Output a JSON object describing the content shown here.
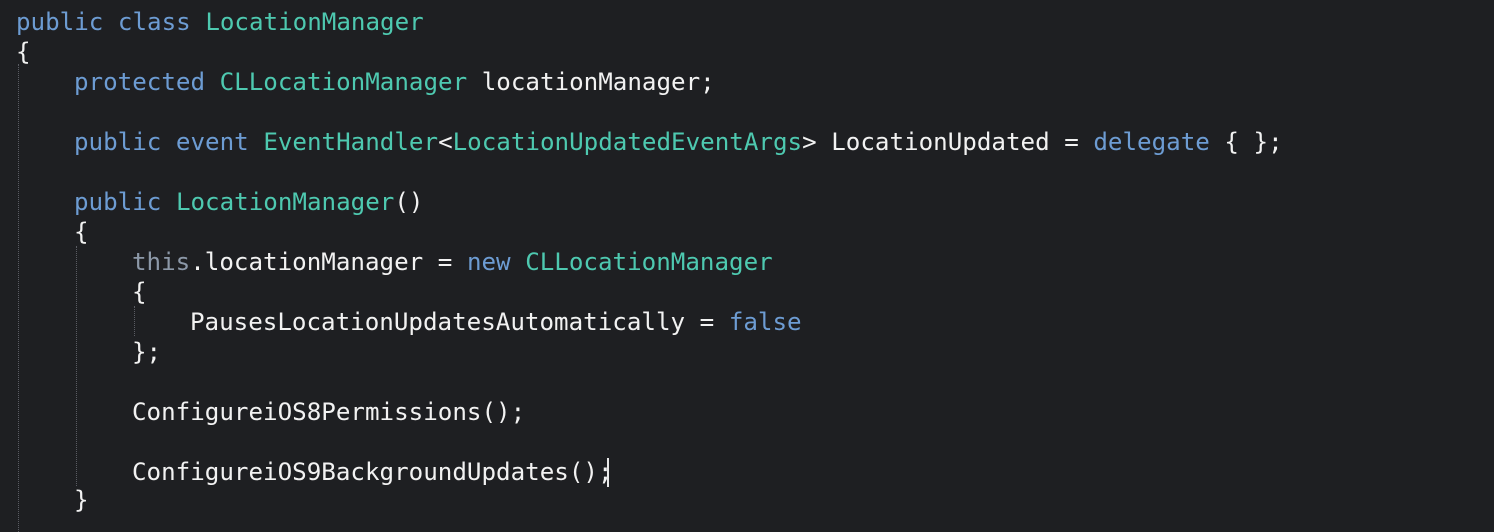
{
  "editor": {
    "colors": {
      "background": "#1e1f22",
      "keyword": "#6d9cd3",
      "type": "#4ec9b0",
      "this_keyword": "#8c98a8",
      "text": "#f2f2f2"
    },
    "lines": [
      {
        "indent": 0,
        "tokens": [
          {
            "t": "public class ",
            "c": "kw"
          },
          {
            "t": "LocationManager",
            "c": "ty"
          }
        ]
      },
      {
        "indent": 0,
        "tokens": [
          {
            "t": "{",
            "c": "tx"
          }
        ]
      },
      {
        "indent": 1,
        "tokens": [
          {
            "t": "protected ",
            "c": "kw"
          },
          {
            "t": "CLLocationManager",
            "c": "ty"
          },
          {
            "t": " locationManager;",
            "c": "tx"
          }
        ]
      },
      {
        "indent": 1,
        "tokens": [
          {
            "t": "public event ",
            "c": "kw"
          },
          {
            "t": "EventHandler",
            "c": "ty"
          },
          {
            "t": "<",
            "c": "tx"
          },
          {
            "t": "LocationUpdatedEventArgs",
            "c": "ty"
          },
          {
            "t": "> LocationUpdated = ",
            "c": "tx"
          },
          {
            "t": "delegate",
            "c": "kw"
          },
          {
            "t": " { };",
            "c": "tx"
          }
        ]
      },
      {
        "indent": 1,
        "tokens": [
          {
            "t": "public ",
            "c": "kw"
          },
          {
            "t": "LocationManager",
            "c": "ty"
          },
          {
            "t": "()",
            "c": "tx"
          }
        ]
      },
      {
        "indent": 1,
        "tokens": [
          {
            "t": "{",
            "c": "tx"
          }
        ]
      },
      {
        "indent": 2,
        "tokens": [
          {
            "t": "this",
            "c": "th"
          },
          {
            "t": ".locationManager = ",
            "c": "tx"
          },
          {
            "t": "new ",
            "c": "kw"
          },
          {
            "t": "CLLocationManager",
            "c": "ty"
          }
        ]
      },
      {
        "indent": 2,
        "tokens": [
          {
            "t": "{",
            "c": "tx"
          }
        ]
      },
      {
        "indent": 3,
        "tokens": [
          {
            "t": "PausesLocationUpdatesAutomatically = ",
            "c": "tx"
          },
          {
            "t": "false",
            "c": "kw"
          }
        ]
      },
      {
        "indent": 2,
        "tokens": [
          {
            "t": "};",
            "c": "tx"
          }
        ]
      },
      {
        "indent": 2,
        "tokens": [
          {
            "t": "ConfigureiOS8Permissions();",
            "c": "tx"
          }
        ]
      },
      {
        "indent": 2,
        "tokens": [
          {
            "t": "ConfigureiOS9BackgroundUpdates();",
            "c": "tx"
          }
        ]
      },
      {
        "indent": 1,
        "tokens": [
          {
            "t": "}",
            "c": "tx"
          }
        ]
      }
    ]
  }
}
